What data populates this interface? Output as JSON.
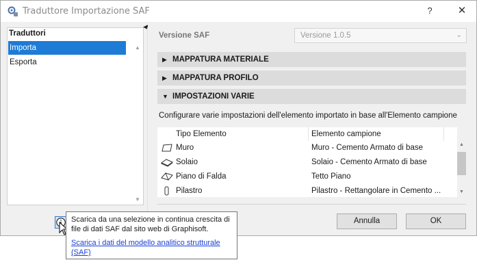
{
  "window": {
    "title": "Traduttore Importazione SAF",
    "help_glyph": "?",
    "close_glyph": "✕"
  },
  "left": {
    "header": "Traduttori",
    "items": [
      {
        "label": "Importa",
        "selected": true
      },
      {
        "label": "Esporta",
        "selected": false
      }
    ]
  },
  "version": {
    "label": "Versione SAF",
    "value": "Versione 1.0.5"
  },
  "sections": [
    {
      "label": "MAPPATURA MATERIALE",
      "expanded": false
    },
    {
      "label": "MAPPATURA PROFILO",
      "expanded": false
    },
    {
      "label": "IMPOSTAZIONI VARIE",
      "expanded": true
    }
  ],
  "description": "Configurare varie impostazioni dell'elemento importato in base all'Elemento campione",
  "table": {
    "headers": [
      "Tipo Elemento",
      "Elemento campione"
    ],
    "rows": [
      {
        "icon": "wall-icon",
        "type": "Muro",
        "sample": "Muro - Cemento Armato di base"
      },
      {
        "icon": "slab-icon",
        "type": "Solaio",
        "sample": "Solaio - Cemento Armato di base"
      },
      {
        "icon": "roof-icon",
        "type": "Piano di Falda",
        "sample": "Tetto Piano"
      },
      {
        "icon": "column-icon",
        "type": "Pilastro",
        "sample": "Pilastro - Rettangolare in Cemento ..."
      }
    ]
  },
  "buttons": {
    "cancel": "Annulla",
    "ok": "OK"
  },
  "tooltip": {
    "text": "Scarica da una selezione in continua crescita di file di dati SAF dal sito web di Graphisoft.",
    "link": "Scarica i dati del modello analitico strutturale (SAF)"
  },
  "colors": {
    "selection": "#1e7bd6",
    "section_bg": "#dcdcdc",
    "link": "#1a3fd1"
  }
}
